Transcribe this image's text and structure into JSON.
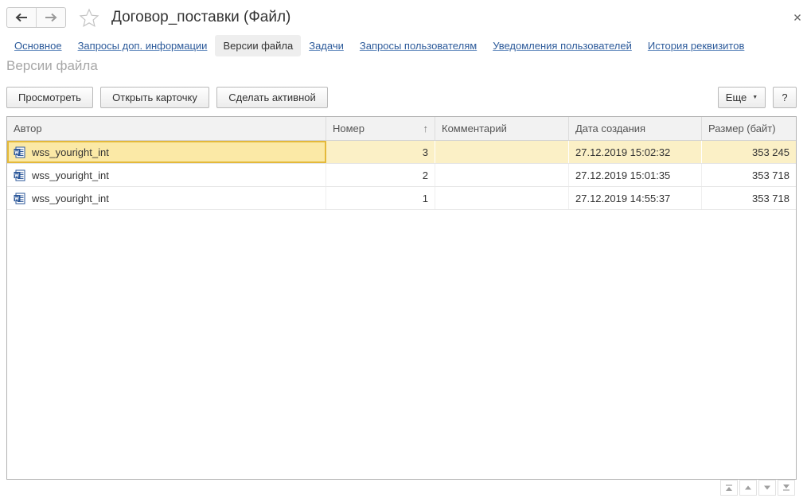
{
  "window": {
    "title": "Договор_поставки (Файл)"
  },
  "icons": {
    "back": "arrow-left-icon",
    "forward": "arrow-right-icon",
    "favorite": "star-icon",
    "close": "close-icon",
    "file": "word-document-icon"
  },
  "tabs": [
    {
      "label": "Основное",
      "active": false
    },
    {
      "label": "Запросы доп. информации",
      "active": false
    },
    {
      "label": "Версии файла",
      "active": true
    },
    {
      "label": "Задачи",
      "active": false
    },
    {
      "label": "Запросы пользователям",
      "active": false
    },
    {
      "label": "Уведомления пользователей",
      "active": false
    },
    {
      "label": "История реквизитов",
      "active": false
    }
  ],
  "section_title": "Версии файла",
  "toolbar": {
    "view_label": "Просмотреть",
    "open_card_label": "Открыть карточку",
    "make_active_label": "Сделать активной",
    "more_label": "Еще",
    "help_label": "?"
  },
  "table": {
    "columns": [
      "Автор",
      "Номер",
      "Комментарий",
      "Дата создания",
      "Размер (байт)"
    ],
    "sort_indicator": "↑",
    "rows": [
      {
        "author": "wss_youright_int",
        "number": "3",
        "comment": "",
        "created": "27.12.2019 15:02:32",
        "size": "353 245",
        "selected": true
      },
      {
        "author": "wss_youright_int",
        "number": "2",
        "comment": "",
        "created": "27.12.2019 15:01:35",
        "size": "353 718",
        "selected": false
      },
      {
        "author": "wss_youright_int",
        "number": "1",
        "comment": "",
        "created": "27.12.2019 14:55:37",
        "size": "353 718",
        "selected": false
      }
    ]
  },
  "colors": {
    "link": "#2c5a9a",
    "selected_row": "#fbf0c6",
    "focus_border": "#e4b93a",
    "word_icon": "#2b579a"
  }
}
